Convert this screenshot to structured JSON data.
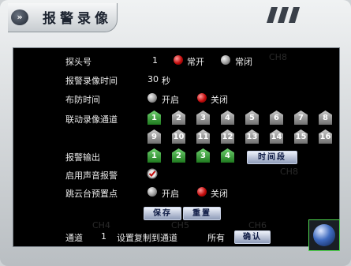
{
  "window": {
    "title": "报警录像",
    "expand_glyph": "»"
  },
  "probe": {
    "label": "探头号",
    "number": "1",
    "options": [
      "常开",
      "常闭"
    ],
    "selected": "常开"
  },
  "record_time": {
    "label": "报警录像时间",
    "value": "30",
    "unit": "秒"
  },
  "arm_time": {
    "label": "布防时间",
    "options": [
      "开启",
      "关闭"
    ],
    "selected": "关闭"
  },
  "linked_channels": {
    "label": "联动录像通道",
    "items": [
      {
        "num": "1",
        "state": "selected"
      },
      {
        "num": "2",
        "state": "off"
      },
      {
        "num": "3",
        "state": "off"
      },
      {
        "num": "4",
        "state": "off"
      },
      {
        "num": "5",
        "state": "off"
      },
      {
        "num": "6",
        "state": "off"
      },
      {
        "num": "7",
        "state": "off"
      },
      {
        "num": "8",
        "state": "off"
      },
      {
        "num": "9",
        "state": "off"
      },
      {
        "num": "10",
        "state": "off"
      },
      {
        "num": "11",
        "state": "off"
      },
      {
        "num": "12",
        "state": "off"
      },
      {
        "num": "13",
        "state": "off"
      },
      {
        "num": "14",
        "state": "off"
      },
      {
        "num": "15",
        "state": "off"
      },
      {
        "num": "16",
        "state": "off"
      }
    ]
  },
  "alarm_output": {
    "label": "报警输出",
    "items": [
      {
        "num": "1",
        "state": "selected"
      },
      {
        "num": "2",
        "state": "selected"
      },
      {
        "num": "3",
        "state": "selected"
      },
      {
        "num": "4",
        "state": "selected"
      }
    ],
    "time_button": "时间段"
  },
  "sound_alarm": {
    "label": "启用声音报警",
    "checked": true
  },
  "ptz_preset": {
    "label": "跳云台预置点",
    "options": [
      "开启",
      "关闭"
    ],
    "selected": "关闭"
  },
  "buttons": {
    "save": "保存",
    "reset": "重置",
    "confirm": "确认"
  },
  "copy": {
    "channel_label": "通道",
    "channel_value": "1",
    "copy_to_label": "设置复制到通道",
    "copy_to_value": "所有"
  },
  "colors": {
    "selected_channel": "#2e9a2e",
    "radio_on": "#c20b0b",
    "panel_bg": "#000000"
  }
}
